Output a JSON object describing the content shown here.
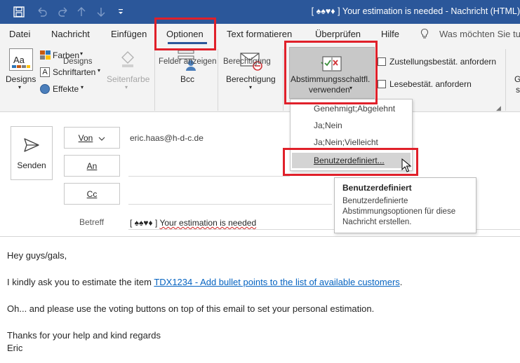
{
  "window": {
    "title": "[ ♠♠♥♦ ] Your estimation is needed  -  Nachricht (HTML)"
  },
  "quick_access": {
    "save_icon": "save-icon",
    "undo_icon": "undo-icon",
    "redo_icon": "redo-icon",
    "up_icon": "arrow-up-icon",
    "down_icon": "arrow-down-icon",
    "customize_icon": "customize-qat-icon"
  },
  "tabs": [
    {
      "label": "Datei"
    },
    {
      "label": "Nachricht"
    },
    {
      "label": "Einfügen"
    },
    {
      "label": "Optionen",
      "active": true
    },
    {
      "label": "Text formatieren"
    },
    {
      "label": "Überprüfen"
    },
    {
      "label": "Hilfe"
    }
  ],
  "tell_me": {
    "placeholder": "Was möchten Sie tu"
  },
  "ribbon": {
    "designs": {
      "designs_label": "Designs",
      "farben_label": "Farben",
      "schriftarten_label": "Schriftarten",
      "effekte_label": "Effekte",
      "seitenfarbe_label": "Seitenfarbe",
      "group_label": "Designs"
    },
    "felder": {
      "bcc_label": "Bcc",
      "group_label": "Felder anzeigen"
    },
    "berechtigung": {
      "berechtigung_label": "Berechtigung",
      "group_label": "Berechtigung"
    },
    "tracking": {
      "abstimmung_label_line1": "Abstimmungsschaltfl.",
      "abstimmung_label_line2": "verwenden",
      "zustellung_label": "Zustellungsbestät. anfordern",
      "lese_label": "Lesebestät. anfordern",
      "partial_label_line1": "G",
      "partial_label_line2": "s"
    }
  },
  "voting_dropdown": {
    "items": [
      {
        "label": "Genehmigt;Abgelehnt"
      },
      {
        "label": "Ja;Nein"
      },
      {
        "label": "Ja;Nein;Vielleicht"
      },
      {
        "label": "Benutzerdefiniert..."
      }
    ]
  },
  "tooltip": {
    "title": "Benutzerdefiniert",
    "description": "Benutzerdefinierte Abstimmungsoptionen für diese Nachricht erstellen."
  },
  "header": {
    "send_label": "Senden",
    "from_label": "Von",
    "from_value": "eric.haas@h-d-c.de",
    "to_label": "An",
    "cc_label": "Cc",
    "subject_label": "Betreff",
    "subject_prefix": "[ ♠♠♥♦ ]",
    "subject_text": "Your estimation is needed"
  },
  "body": {
    "greeting": "Hey guys/gals,",
    "ask_prefix": "I kindly ask you to estimate the item ",
    "ask_link": "TDX1234 - Add bullet points to the list of available customers",
    "ask_suffix": ".",
    "voting_hint": "Oh... and please use the voting buttons on top of this email to set your personal estimation.",
    "thanks": "Thanks for your help and kind regards",
    "signature": "Eric"
  },
  "colors": {
    "titlebar": "#2b579a",
    "highlight": "#e0202a",
    "link": "#0563c1"
  }
}
